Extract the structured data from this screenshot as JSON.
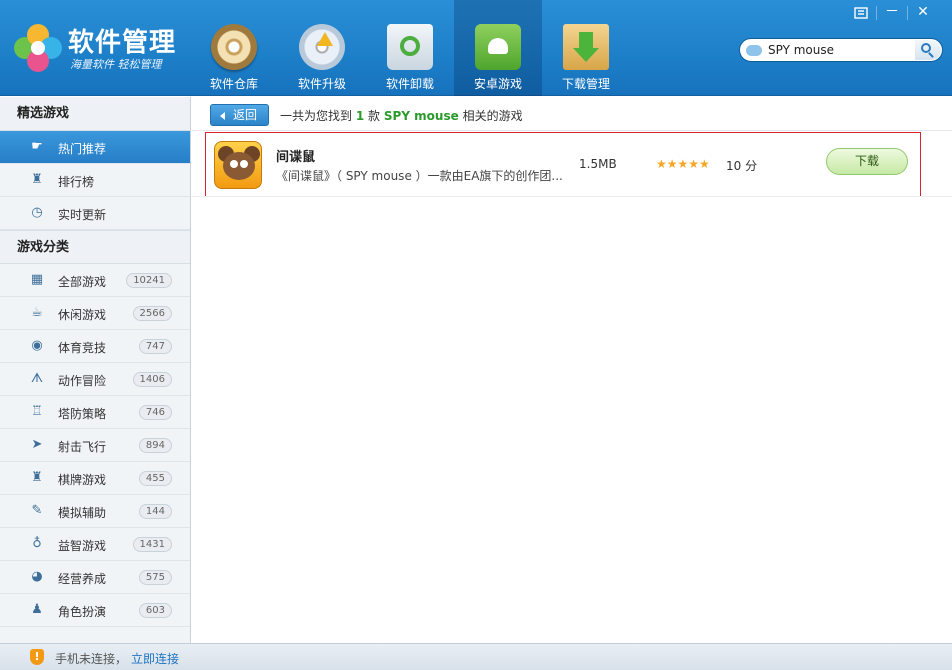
{
  "app": {
    "title": "软件管理",
    "slogan": "海量软件 轻松管理"
  },
  "window_controls": {
    "menu_icon": "menu-icon",
    "minimize": "－",
    "close": "✕"
  },
  "nav": {
    "tabs": [
      {
        "label": "软件仓库",
        "icon": "software-store-icon",
        "active": false
      },
      {
        "label": "软件升级",
        "icon": "upgrade-icon",
        "active": false
      },
      {
        "label": "软件卸载",
        "icon": "uninstall-icon",
        "active": false
      },
      {
        "label": "安卓游戏",
        "icon": "android-games-icon",
        "active": true
      },
      {
        "label": "下载管理",
        "icon": "download-manager-icon",
        "active": false
      }
    ]
  },
  "search": {
    "value": "SPY mouse"
  },
  "sidebar": {
    "section1_title": "精选游戏",
    "featured": [
      {
        "label": "热门推荐",
        "icon": "hand-pointer-icon",
        "active": true
      },
      {
        "label": "排行榜",
        "icon": "trophy-icon",
        "active": false
      },
      {
        "label": "实时更新",
        "icon": "clock-icon",
        "active": false
      }
    ],
    "section2_title": "游戏分类",
    "categories": [
      {
        "label": "全部游戏",
        "count": "10241",
        "icon": "grid-icon"
      },
      {
        "label": "休闲游戏",
        "count": "2566",
        "icon": "coffee-cup-icon"
      },
      {
        "label": "体育竞技",
        "count": "747",
        "icon": "ball-icon"
      },
      {
        "label": "动作冒险",
        "count": "1406",
        "icon": "running-man-icon"
      },
      {
        "label": "塔防策略",
        "count": "746",
        "icon": "tower-icon"
      },
      {
        "label": "射击飞行",
        "count": "894",
        "icon": "paper-plane-icon"
      },
      {
        "label": "棋牌游戏",
        "count": "455",
        "icon": "chess-icon"
      },
      {
        "label": "模拟辅助",
        "count": "144",
        "icon": "wrench-icon"
      },
      {
        "label": "益智游戏",
        "count": "1431",
        "icon": "lightbulb-icon"
      },
      {
        "label": "经营养成",
        "count": "575",
        "icon": "pie-icon"
      },
      {
        "label": "角色扮演",
        "count": "603",
        "icon": "character-icon"
      }
    ]
  },
  "results": {
    "back_label": "返回",
    "prefix": "一共为您找到",
    "count": "1",
    "unit": "款",
    "keyword": "SPY mouse",
    "suffix": "相关的游戏",
    "items": [
      {
        "name": "间谍鼠",
        "description": "《间谍鼠》（ SPY mouse ）一款由EA旗下的创作团...",
        "size": "1.5MB",
        "stars": "★★★★★",
        "score": "10 分",
        "download_label": "下载"
      }
    ]
  },
  "status": {
    "text": "手机未连接，",
    "link": "立即连接"
  }
}
